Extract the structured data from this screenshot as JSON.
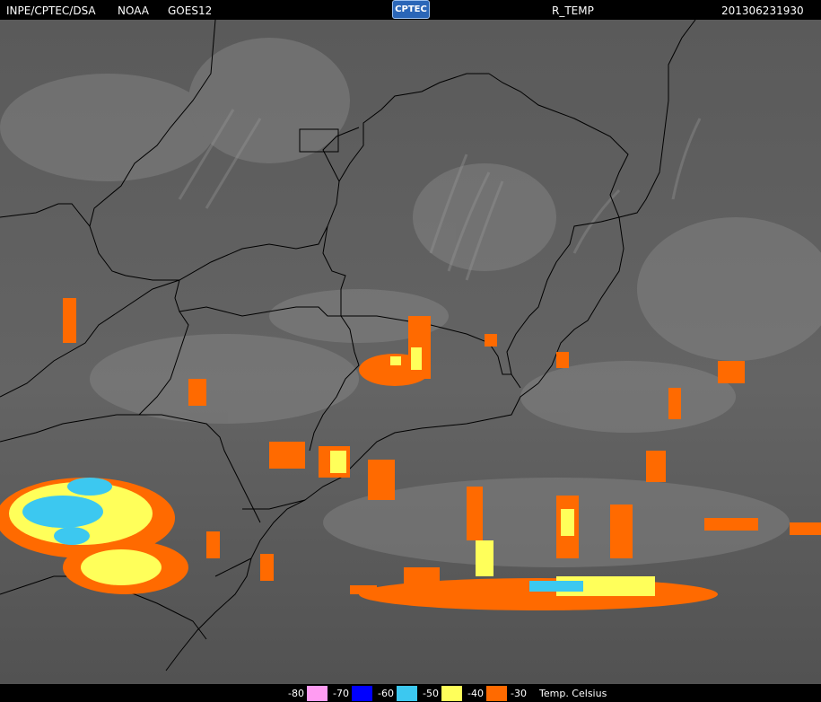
{
  "header": {
    "source": "INPE/CPTEC/DSA",
    "agency": "NOAA",
    "satellite": "GOES12",
    "logo_text": "CPTEC",
    "product": "R_TEMP",
    "timestamp": "201306231930"
  },
  "legend": {
    "items": [
      {
        "label": "-80",
        "color": "#ff9cf2"
      },
      {
        "label": "-70",
        "color": "#ff9cf2"
      },
      {
        "label": "-60",
        "color": "#0000ff"
      },
      {
        "label": "-50",
        "color": "#3cc8f0"
      },
      {
        "label": "-40",
        "color": "#ffff5a"
      },
      {
        "label": "-30",
        "color": "#ff6a00"
      }
    ],
    "unit": "Temp. Celsius"
  },
  "colors": {
    "background_gray": "#5a5a5a",
    "border_lines": "#000000"
  }
}
